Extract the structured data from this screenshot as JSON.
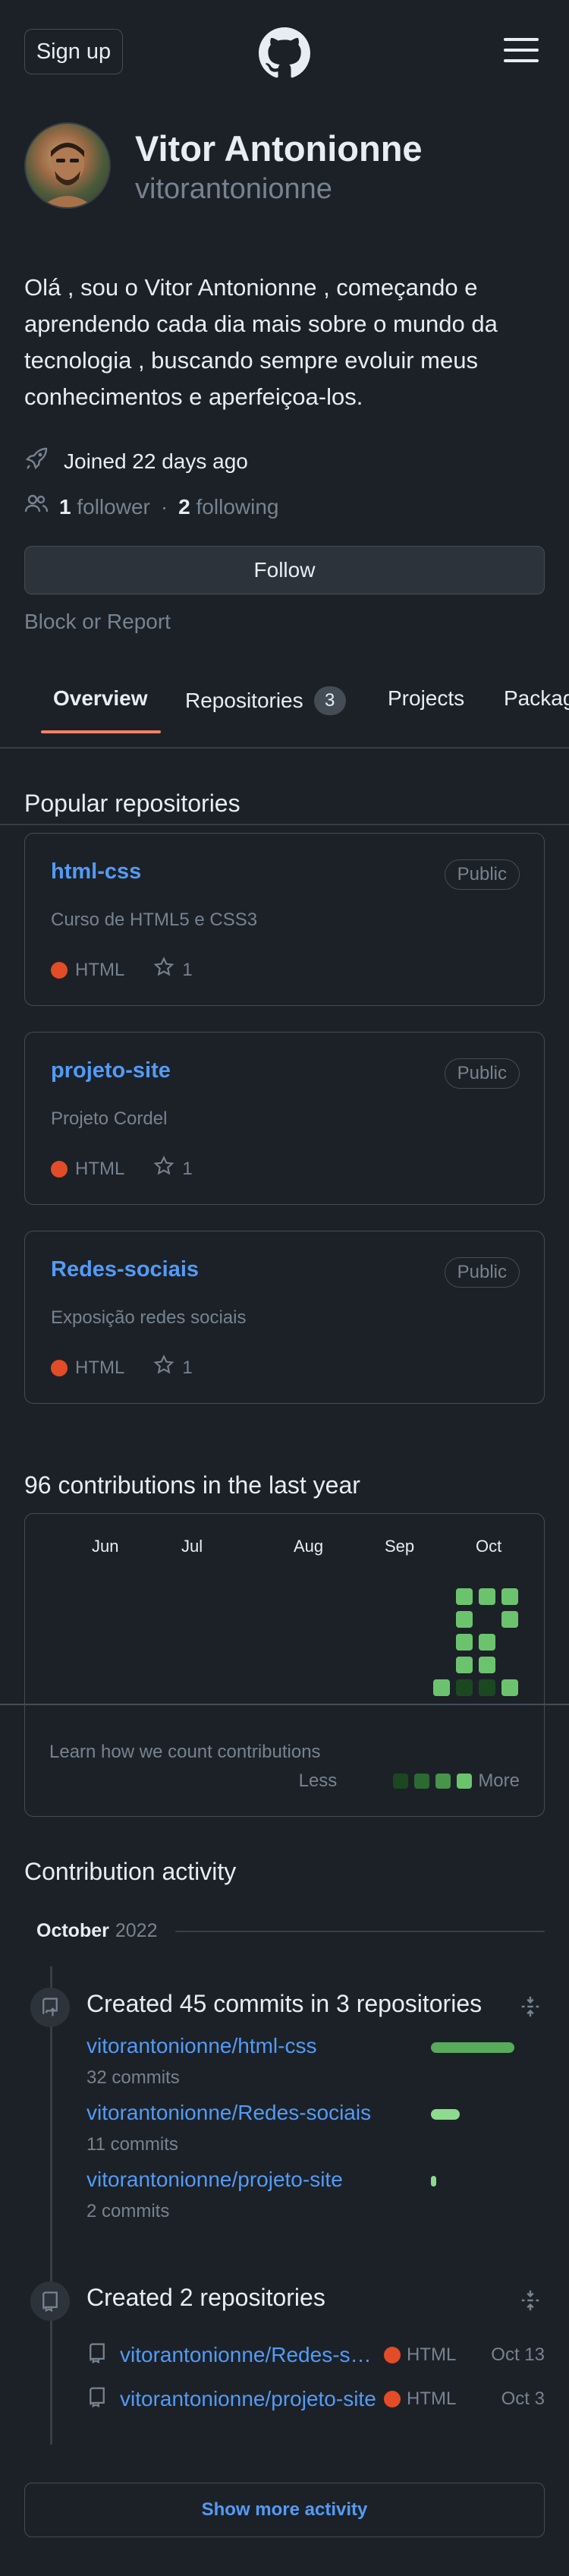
{
  "header": {
    "signup_label": "Sign up"
  },
  "profile": {
    "name": "Vitor Antonionne",
    "login": "vitorantonionne",
    "bio": "Olá , sou o Vitor Antonionne , começando e aprendendo cada dia mais sobre o mundo da tecnologia , buscando sempre evoluir meus conhecimentos e aperfeiçoa-los.",
    "joined": "Joined 22 days ago",
    "followers_count": "1",
    "followers_label": "follower",
    "following_count": "2",
    "following_label": "following",
    "separator": "·",
    "follow_label": "Follow",
    "block_label": "Block or Report"
  },
  "tabs": [
    {
      "label": "Overview"
    },
    {
      "label": "Repositories",
      "count": "3"
    },
    {
      "label": "Projects"
    },
    {
      "label": "Packages"
    }
  ],
  "popular": {
    "title": "Popular repositories",
    "repos": [
      {
        "name": "html-css",
        "badge": "Public",
        "desc": "Curso de HTML5 e CSS3",
        "lang": "HTML",
        "stars": "1"
      },
      {
        "name": "projeto-site",
        "badge": "Public",
        "desc": "Projeto Cordel",
        "lang": "HTML",
        "stars": "1"
      },
      {
        "name": "Redes-sociais",
        "badge": "Public",
        "desc": "Exposição redes sociais",
        "lang": "HTML",
        "stars": "1"
      }
    ]
  },
  "contributions": {
    "title": "96 contributions in the last year",
    "months": [
      "Jun",
      "Jul",
      "Aug",
      "Sep",
      "Oct"
    ],
    "learn": "Learn how we count contributions",
    "less": "Less",
    "more": "More",
    "colors": {
      "l1": "#1b4721",
      "l2": "#2b6a30",
      "l3": "#46954a",
      "l4": "#6bc46d"
    }
  },
  "activity": {
    "title": "Contribution activity",
    "month_name": "October",
    "year": "2022",
    "commits_title": "Created 45 commits in 3 repositories",
    "commit_repos": [
      {
        "name": "vitorantonionne/html-css",
        "count": "32 commits",
        "commits": 32
      },
      {
        "name": "vitorantonionne/Redes-sociais",
        "count": "11 commits",
        "commits": 11
      },
      {
        "name": "vitorantonionne/projeto-site",
        "count": "2 commits",
        "commits": 2
      }
    ],
    "created_title": "Created 2 repositories",
    "created_repos": [
      {
        "name": "vitorantonionne/Redes-sociais",
        "lang": "HTML",
        "date": "Oct 13"
      },
      {
        "name": "vitorantonionne/projeto-site",
        "lang": "HTML",
        "date": "Oct 3"
      }
    ],
    "show_more": "Show more activity"
  }
}
